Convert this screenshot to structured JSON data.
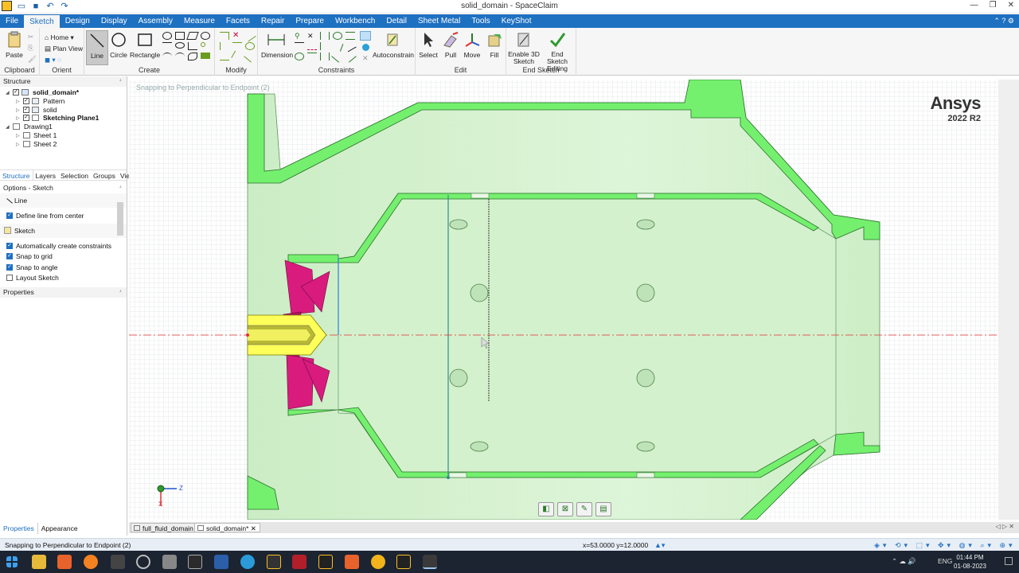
{
  "window": {
    "title": "solid_domain - SpaceClaim"
  },
  "menu": [
    "File",
    "Sketch",
    "Design",
    "Display",
    "Assembly",
    "Measure",
    "Facets",
    "Repair",
    "Prepare",
    "Workbench",
    "Detail",
    "Sheet Metal",
    "Tools",
    "KeyShot"
  ],
  "menu_active": "Sketch",
  "ribbon": {
    "clipboard": {
      "paste": "Paste",
      "label": "Clipboard"
    },
    "orient": {
      "home": "Home",
      "plan_view": "Plan View",
      "label": "Orient"
    },
    "create": {
      "line": "Line",
      "circle": "Circle",
      "rectangle": "Rectangle",
      "label": "Create"
    },
    "modify": {
      "label": "Modify"
    },
    "constraints": {
      "dimension": "Dimension",
      "autoconstrain": "Autoconstrain",
      "label": "Constraints"
    },
    "edit": {
      "select": "Select",
      "pull": "Pull",
      "move": "Move",
      "fill": "Fill",
      "label": "Edit"
    },
    "end_sketch": {
      "enable3d": "Enable 3D Sketch",
      "end_editing": "End Sketch Editing",
      "label": "End Sketch"
    }
  },
  "structure": {
    "header": "Structure",
    "items": [
      {
        "label": "solid_domain*",
        "bold": true
      },
      {
        "label": "Pattern"
      },
      {
        "label": "solid"
      },
      {
        "label": "Sketching Plane1",
        "bold": true
      },
      {
        "label": "Drawing1"
      },
      {
        "label": "Sheet 1"
      },
      {
        "label": "Sheet 2"
      }
    ]
  },
  "panel_tabs": [
    "Structure",
    "Layers",
    "Selection",
    "Groups",
    "Views"
  ],
  "options": {
    "header": "Options - Sketch",
    "line_section": "Line",
    "define_line": "Define line from center",
    "sketch_section": "Sketch",
    "auto_constraints": "Automatically create constraints",
    "snap_grid": "Snap to grid",
    "snap_angle": "Snap to angle",
    "layout_sketch": "Layout Sketch"
  },
  "properties_header": "Properties",
  "bottom_tabs": [
    "Properties",
    "Appearance"
  ],
  "canvas": {
    "snap_hint": "Snapping to Perpendicular to Endpoint (2)",
    "logo": "Ansys",
    "version": "2022 R2",
    "triad_x": "X",
    "triad_z": "Z"
  },
  "doc_tabs": [
    {
      "label": "full_fluid_domain"
    },
    {
      "label": "solid_domain*",
      "active": true
    }
  ],
  "status": {
    "message": "Snapping to Perpendicular to Endpoint (2)",
    "coords": "x=53.0000  y=12.0000"
  },
  "taskbar": {
    "lang": "ENG",
    "time": "01:44 PM",
    "date": "01-08-2023"
  },
  "colors": {
    "accent": "#1e70c1",
    "solid_green": "#7ef77a",
    "fill_green": "#d7f4d2",
    "yellow": "#ffff60",
    "magenta": "#d81b7d"
  }
}
